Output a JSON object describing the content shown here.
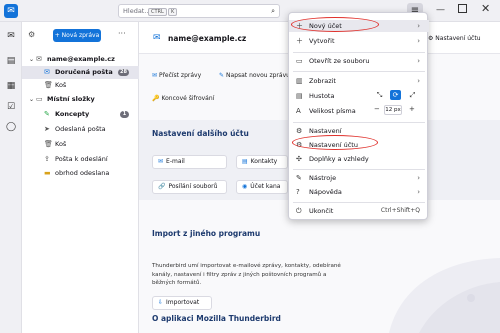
{
  "titlebar": {
    "search_placeholder": "Hledat...",
    "kbd_ctrl": "CTRL",
    "kbd_k": "K"
  },
  "folder_pane": {
    "new_message": "+ Nová zpráva",
    "more": "···",
    "items": [
      {
        "label": "name@example.cz",
        "bold": true
      },
      {
        "label": "Doručená pošta",
        "count": "28",
        "bold": true
      },
      {
        "label": "Koš"
      },
      {
        "label": "Místní složky",
        "bold": true
      },
      {
        "label": "Koncepty",
        "count": "1",
        "bold": true
      },
      {
        "label": "Odeslaná pošta"
      },
      {
        "label": "Koš"
      },
      {
        "label": "Pošta k odeslání"
      },
      {
        "label": "obrhod odeslana"
      }
    ]
  },
  "main": {
    "account_title": "name@example.cz",
    "account_settings": "Nastavení účtu",
    "actions": [
      "Přečíst zprávy",
      "Napsat novou zprávu",
      "Hledat zprávy",
      "Nastavení filtrů zpráv",
      "Koncové šifrování"
    ],
    "setup_title": "Nastavení dalšího účtu",
    "setup_cards": [
      "E-mail",
      "Kontakty",
      "Posílání souborů",
      "Účet kana"
    ],
    "import_title": "Import z jiného programu",
    "import_text": "Thunderbird umí importovat e-mailové zprávy, kontakty, odebírané kanály, nastavení i filtry zpráv z jiných poštovních programů a běžných formátů.",
    "import_button": "Importovat",
    "about_title": "O aplikaci Mozilla Thunderbird"
  },
  "app_menu": {
    "new_account": "Nový účet",
    "create": "Vytvořit",
    "open_file": "Otevřít ze souboru",
    "view": "Zobrazit",
    "density": "Hustota",
    "font_size": "Velikost písma",
    "font_size_value": "12 px",
    "settings": "Nastavení",
    "account_settings": "Nastavení účtu",
    "addons": "Doplňky a vzhledy",
    "tools": "Nástroje",
    "help": "Nápověda",
    "quit": "Ukončit",
    "quit_shortcut": "Ctrl+Shift+Q"
  },
  "colors": {
    "accent": "#1373d9",
    "highlight_ring": "#e0302b"
  }
}
